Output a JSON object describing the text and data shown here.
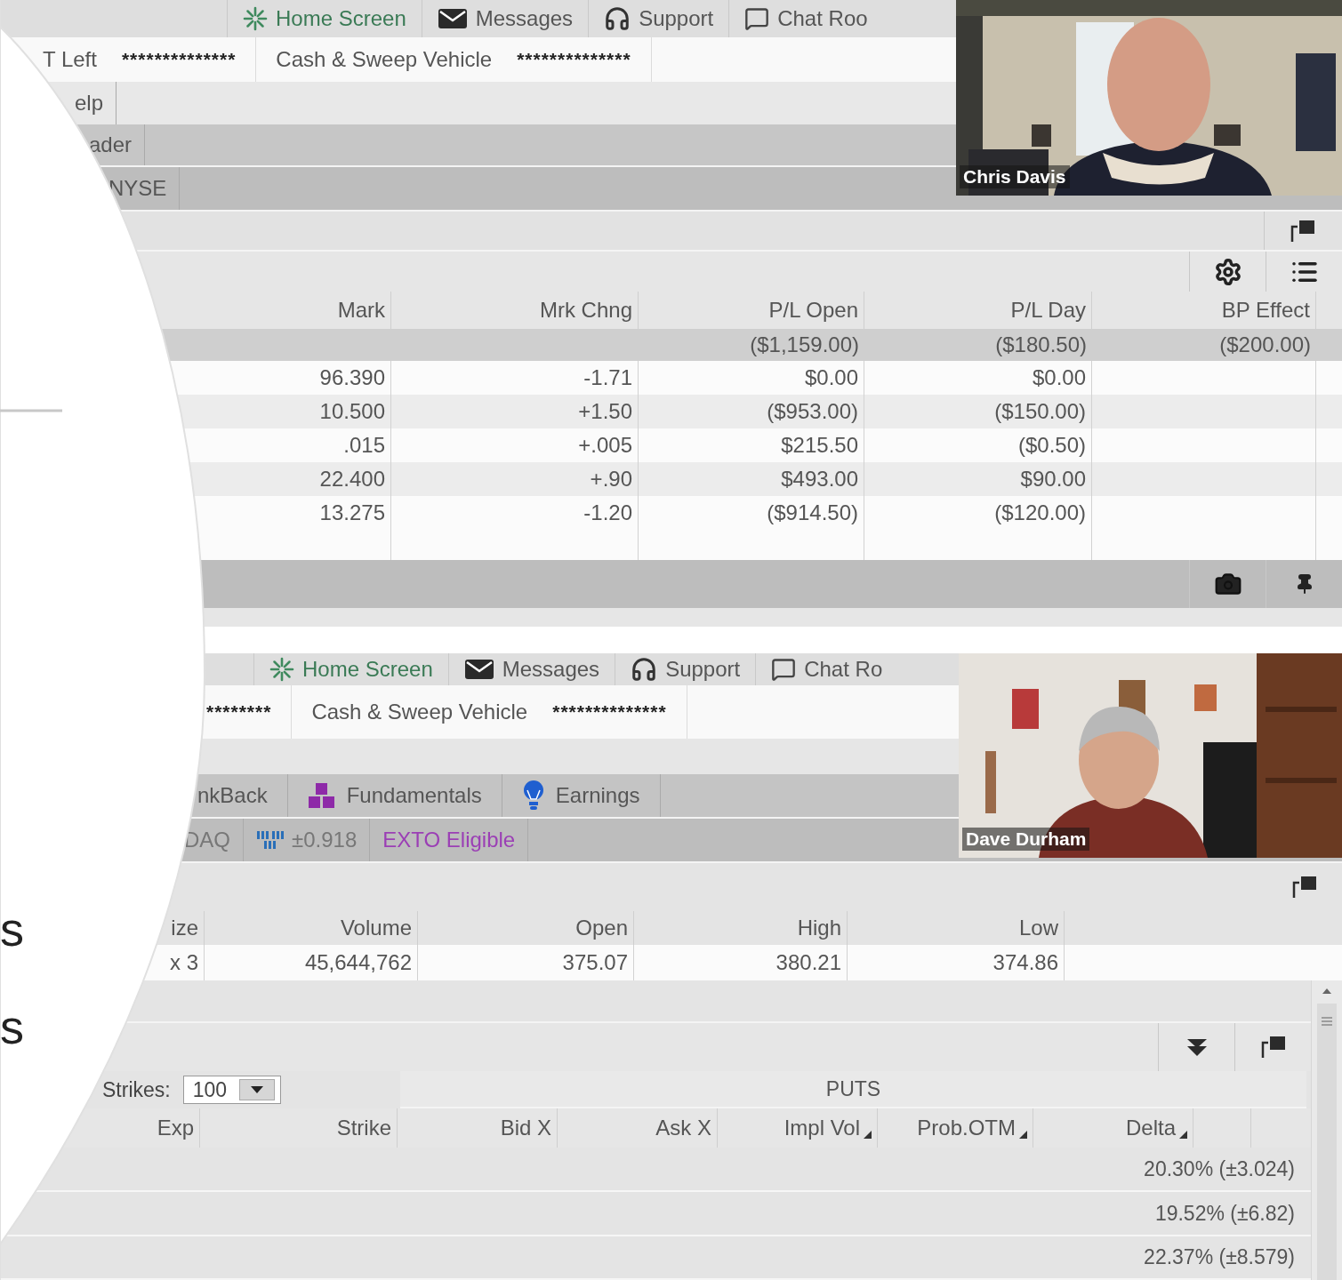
{
  "slide_overlay": {
    "fragments": [
      "s",
      "s"
    ]
  },
  "top_window": {
    "nav_tabs": [
      {
        "kind": "home",
        "label": "Home Screen"
      },
      {
        "kind": "mail",
        "label": "Messages"
      },
      {
        "kind": "headset",
        "label": "Support"
      },
      {
        "kind": "chat",
        "label": "Chat Roo"
      }
    ],
    "account_bar": [
      {
        "label": "T Left",
        "value": "**************"
      },
      {
        "label": "Cash & Sweep Vehicle",
        "value": "**************"
      }
    ],
    "menu": "elp",
    "section_tab": "ader",
    "exchange": "NYSE",
    "positions": {
      "columns": [
        "Mark",
        "Mrk Chng",
        "P/L Open",
        "P/L Day",
        "BP Effect"
      ],
      "totals": [
        "($1,159.00)",
        "($180.50)",
        "($200.00)"
      ],
      "rows": [
        {
          "cells": [
            "96.390",
            "-1.71",
            "$0.00",
            "$0.00"
          ]
        },
        {
          "cells": [
            "10.500",
            "+1.50",
            "($953.00)",
            "($150.00)"
          ]
        },
        {
          "cells": [
            ".015",
            "+.005",
            "$215.50",
            "($0.50)"
          ]
        },
        {
          "cells": [
            "22.400",
            "+.90",
            "$493.00",
            "$90.00"
          ]
        },
        {
          "cells": [
            "13.275",
            "-1.20",
            "($914.50)",
            "($120.00)"
          ]
        }
      ]
    },
    "video": {
      "kind": "picture",
      "name": "Chris Davis"
    }
  },
  "bottom_window": {
    "nav_tabs": [
      {
        "kind": "home",
        "label": "Home Screen"
      },
      {
        "kind": "mail",
        "label": "Messages"
      },
      {
        "kind": "headset",
        "label": "Support"
      },
      {
        "kind": "chat",
        "label": "Chat Ro"
      }
    ],
    "account_bar": [
      {
        "value": "********"
      },
      {
        "label": "Cash & Sweep Vehicle",
        "value": "**************"
      }
    ],
    "tool_tabs": [
      {
        "kind": "plain",
        "label": "nkBack"
      },
      {
        "kind": "fundamentals",
        "label": "Fundamentals"
      },
      {
        "kind": "earnings",
        "label": "Earnings"
      }
    ],
    "quote_bar": [
      {
        "kind": "plain",
        "text": "DAQ"
      },
      {
        "kind": "mm",
        "text": "±0.918"
      },
      {
        "kind": "exto",
        "text": "EXTO Eligible"
      }
    ],
    "quote_table": {
      "columns": [
        "ize",
        "Volume",
        "Open",
        "High",
        "Low"
      ],
      "row": [
        "x 3",
        "45,644,762",
        "375.07",
        "380.21",
        "374.86"
      ]
    },
    "option_chain": {
      "strikes_label": "Strikes:",
      "strikes_value": "100",
      "side": "PUTS",
      "columns": [
        {
          "label": "Exp",
          "sortable": false
        },
        {
          "label": "Strike",
          "sortable": false
        },
        {
          "label": "Bid X",
          "sortable": false
        },
        {
          "label": "Ask X",
          "sortable": false
        },
        {
          "label": "Impl Vol",
          "sortable": true
        },
        {
          "label": "Prob.OTM",
          "sortable": true
        },
        {
          "label": "Delta",
          "sortable": true
        }
      ],
      "rows": [
        "20.30% (±3.024)",
        "19.52% (±6.82)",
        "22.37% (±8.579)"
      ]
    },
    "video": {
      "kind": "picture",
      "name": "Dave Durham"
    }
  }
}
